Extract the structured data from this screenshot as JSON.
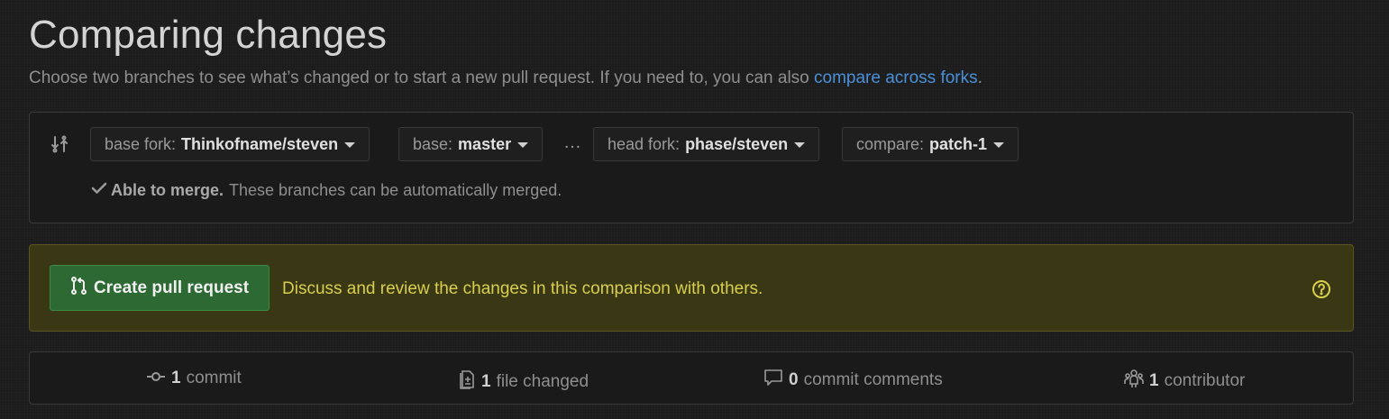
{
  "header": {
    "title": "Comparing changes",
    "subtitle_prefix": "Choose two branches to see what’s changed or to start a new pull request. If you need to, you can also ",
    "subtitle_link": "compare across forks",
    "subtitle_suffix": "."
  },
  "range": {
    "base_fork_label": "base fork:",
    "base_fork_value": "Thinkofname/steven",
    "base_label": "base:",
    "base_value": "master",
    "separator": "…",
    "head_fork_label": "head fork:",
    "head_fork_value": "phase/steven",
    "compare_label": "compare:",
    "compare_value": "patch-1",
    "merge_status_bold": "Able to merge.",
    "merge_status_text": "These branches can be automatically merged."
  },
  "pull_request": {
    "button_label": "Create pull request",
    "description": "Discuss and review the changes in this comparison with others."
  },
  "summary": {
    "commits_count": "1",
    "commits_label": "commit",
    "files_count": "1",
    "files_label": "file changed",
    "comments_count": "0",
    "comments_label": "commit comments",
    "contributors_count": "1",
    "contributors_label": "contributor"
  },
  "colors": {
    "link": "#4a90d9",
    "pr_button": "#2d6a33",
    "banner": "#3a3715",
    "banner_text": "#d9cf4e"
  },
  "icons": [
    "compare-icon",
    "caret-down-icon",
    "check-icon",
    "pull-request-icon",
    "question-icon",
    "commit-icon",
    "file-diff-icon",
    "comment-icon",
    "organization-icon"
  ]
}
